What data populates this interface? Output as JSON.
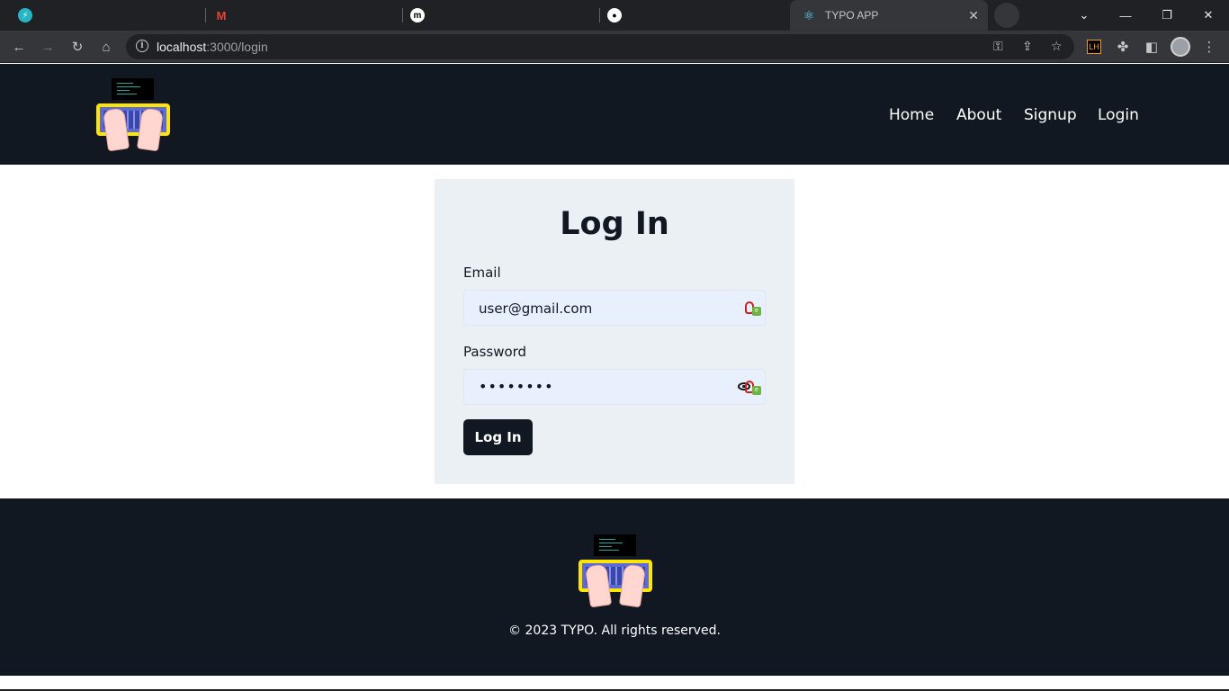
{
  "browser": {
    "tabs": [
      {
        "icon": "bolt-icon",
        "title": ""
      },
      {
        "icon": "gmail-icon",
        "title": ""
      },
      {
        "icon": "medium-icon",
        "title": ""
      },
      {
        "icon": "github-icon",
        "title": ""
      },
      {
        "icon": "react-icon",
        "title": "TYPO APP",
        "active": true
      }
    ],
    "address": {
      "host": "localhost",
      "path": ":3000/login"
    }
  },
  "header": {
    "nav": [
      "Home",
      "About",
      "Signup",
      "Login"
    ]
  },
  "login": {
    "title": "Log In",
    "email_label": "Email",
    "email_value": "user@gmail.com",
    "password_label": "Password",
    "password_value": "••••••••",
    "submit_label": "Log In"
  },
  "footer": {
    "copyright": "© 2023 TYPO. All rights reserved."
  },
  "colors": {
    "header_bg": "#111822",
    "card_bg": "#ebf0f5",
    "input_bg": "#e8f0fe",
    "button_bg": "#111822"
  }
}
